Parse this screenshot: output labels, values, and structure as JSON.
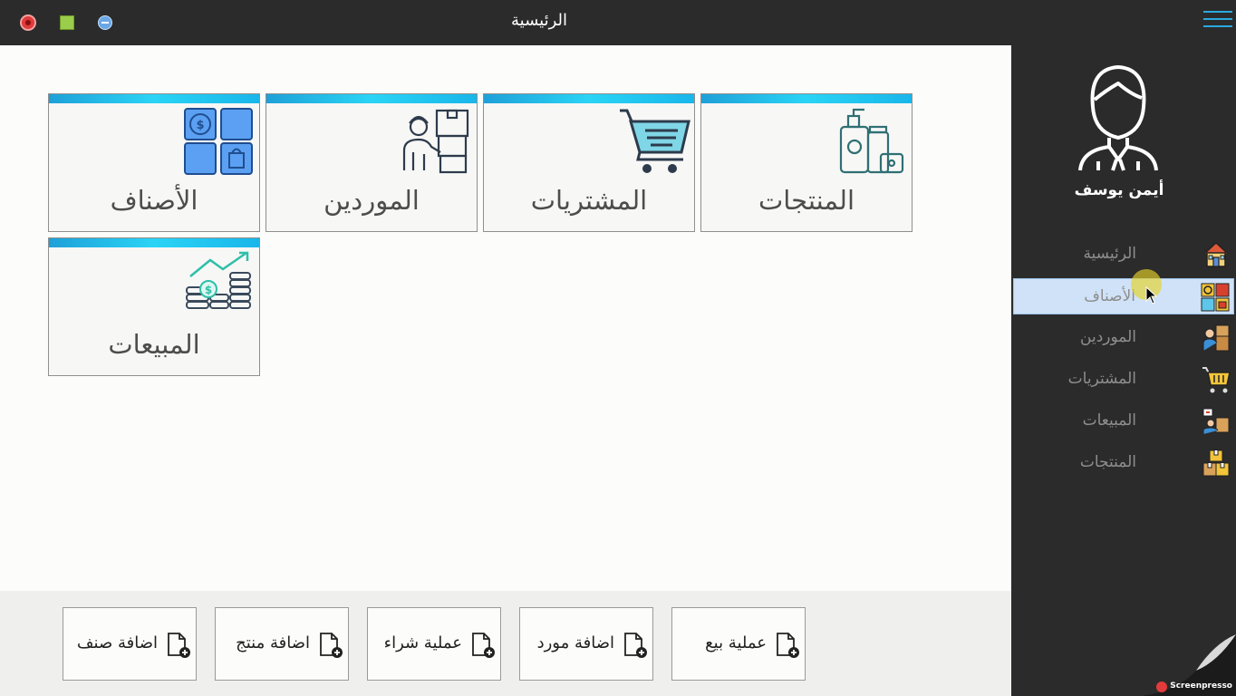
{
  "window": {
    "title": "الرئيسية"
  },
  "sidebar": {
    "user_name": "أيمن يوسف",
    "items": [
      {
        "label": "الرئيسية",
        "icon": "home-icon"
      },
      {
        "label": "الأصناف",
        "icon": "categories-icon",
        "active": true
      },
      {
        "label": "الموردين",
        "icon": "suppliers-icon"
      },
      {
        "label": "المشتريات",
        "icon": "cart-icon"
      },
      {
        "label": "المبيعات",
        "icon": "sales-icon"
      },
      {
        "label": "المنتجات",
        "icon": "products-icon"
      }
    ]
  },
  "tiles": [
    {
      "label": "المنتجات",
      "icon": "products-icon"
    },
    {
      "label": "المشتريات",
      "icon": "cart-icon"
    },
    {
      "label": "الموردين",
      "icon": "suppliers-icon"
    },
    {
      "label": "الأصناف",
      "icon": "categories-icon"
    },
    {
      "label": "المبيعات",
      "icon": "sales-icon"
    }
  ],
  "quick_actions": [
    {
      "label": "عملية بيع",
      "icon": "add-file-icon"
    },
    {
      "label": "اضافة مورد",
      "icon": "add-file-icon"
    },
    {
      "label": "عملية شراء",
      "icon": "add-file-icon"
    },
    {
      "label": "اضافة منتج",
      "icon": "add-file-icon"
    },
    {
      "label": "اضافة صنف",
      "icon": "add-file-icon"
    }
  ],
  "watermark": "Screenpresso",
  "colors": {
    "titlebar": "#2b2b2b",
    "accent": "#1ea0d8",
    "active_item": "#cfe2f7"
  }
}
